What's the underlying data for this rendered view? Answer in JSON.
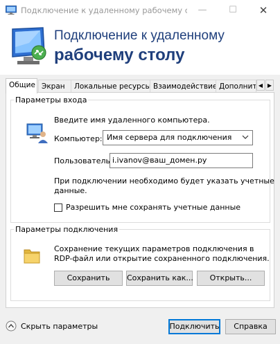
{
  "window": {
    "title": "Подключение к удаленному рабочему с...",
    "minimize_glyph": "—",
    "maximize_glyph": "☐",
    "close_glyph": "✕"
  },
  "banner": {
    "line1": "Подключение к удаленному",
    "line2": "рабочему столу"
  },
  "tabs": [
    {
      "label": "Общие",
      "active": true
    },
    {
      "label": "Экран",
      "active": false
    },
    {
      "label": "Локальные ресурсы",
      "active": false
    },
    {
      "label": "Взаимодействие",
      "active": false
    },
    {
      "label": "Дополнит",
      "active": false
    }
  ],
  "tab_scroll": {
    "left": "◀",
    "right": "▶"
  },
  "login_group": {
    "legend": "Параметры входа",
    "prompt": "Введите имя удаленного компьютера.",
    "computer_label": "Компьютер:",
    "computer_value": "Имя сервера для подключения",
    "user_label": "Пользователь:",
    "user_value": "i.ivanov@ваш_домен.ру",
    "info_line1": "При подключении необходимо будет указать учетные",
    "info_line2": "данные.",
    "save_credentials_label": "Разрешить мне сохранять учетные данные",
    "save_credentials_checked": false
  },
  "connection_group": {
    "legend": "Параметры подключения",
    "desc_line1": "Сохранение текущих параметров подключения в",
    "desc_line2": "RDP-файл или открытие сохраненного подключения.",
    "save_button": "Сохранить",
    "save_as_button": "Сохранить как...",
    "open_button": "Открыть..."
  },
  "footer": {
    "hide_options": "Скрыть параметры",
    "connect_button": "Подключить",
    "help_button": "Справка"
  },
  "colors": {
    "banner_text": "#1f3f7c",
    "accent": "#0078d7"
  }
}
